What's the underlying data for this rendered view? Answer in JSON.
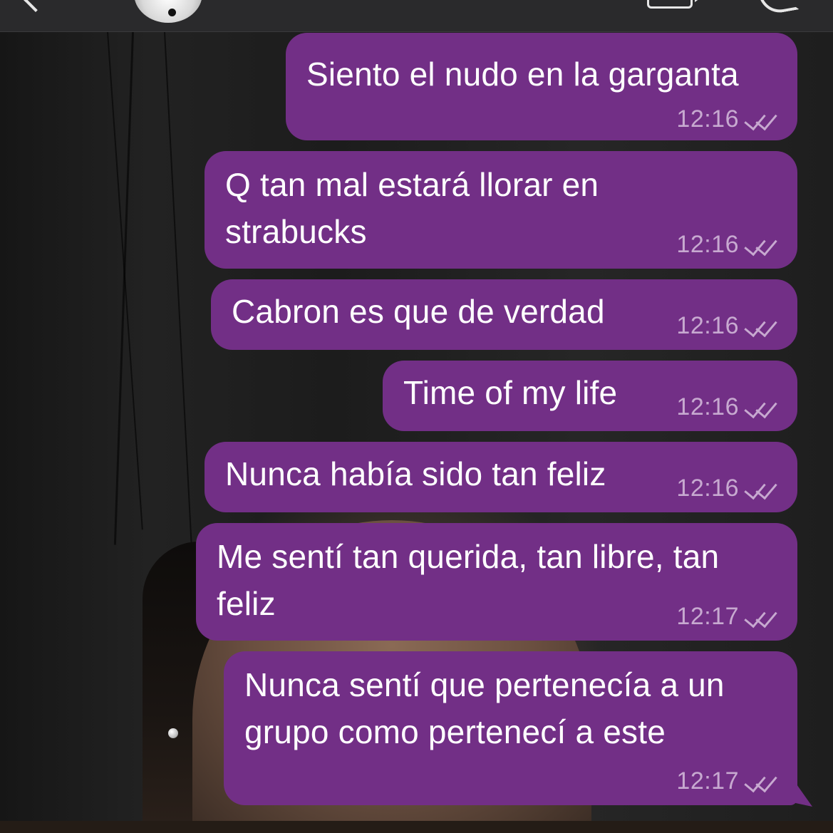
{
  "header": {
    "back_icon": "chevron-left-icon",
    "avatar": "contact-avatar",
    "video_icon": "video-call-icon",
    "phone_icon": "phone-call-icon"
  },
  "colors": {
    "bubble": "#722f86",
    "meta": "#c7a9d0",
    "header": "#2a2a2c"
  },
  "messages": [
    {
      "lines": [
        "Siento el nudo en la garganta"
      ],
      "time": "12:16",
      "status": "read"
    },
    {
      "lines": [
        "Q tan mal estará llorar en",
        "strabucks"
      ],
      "time": "12:16",
      "status": "read"
    },
    {
      "lines": [
        "Cabron es que de verdad"
      ],
      "time": "12:16",
      "status": "read"
    },
    {
      "lines": [
        "Time of my life"
      ],
      "time": "12:16",
      "status": "read"
    },
    {
      "lines": [
        "Nunca había sido tan feliz"
      ],
      "time": "12:16",
      "status": "read"
    },
    {
      "lines": [
        "Me sentí tan querida, tan libre, tan",
        "feliz"
      ],
      "time": "12:17",
      "status": "read"
    },
    {
      "lines": [
        "Nunca sentí que pertenecía a un",
        "grupo como pertenecí a este"
      ],
      "time": "12:17",
      "status": "read"
    }
  ]
}
